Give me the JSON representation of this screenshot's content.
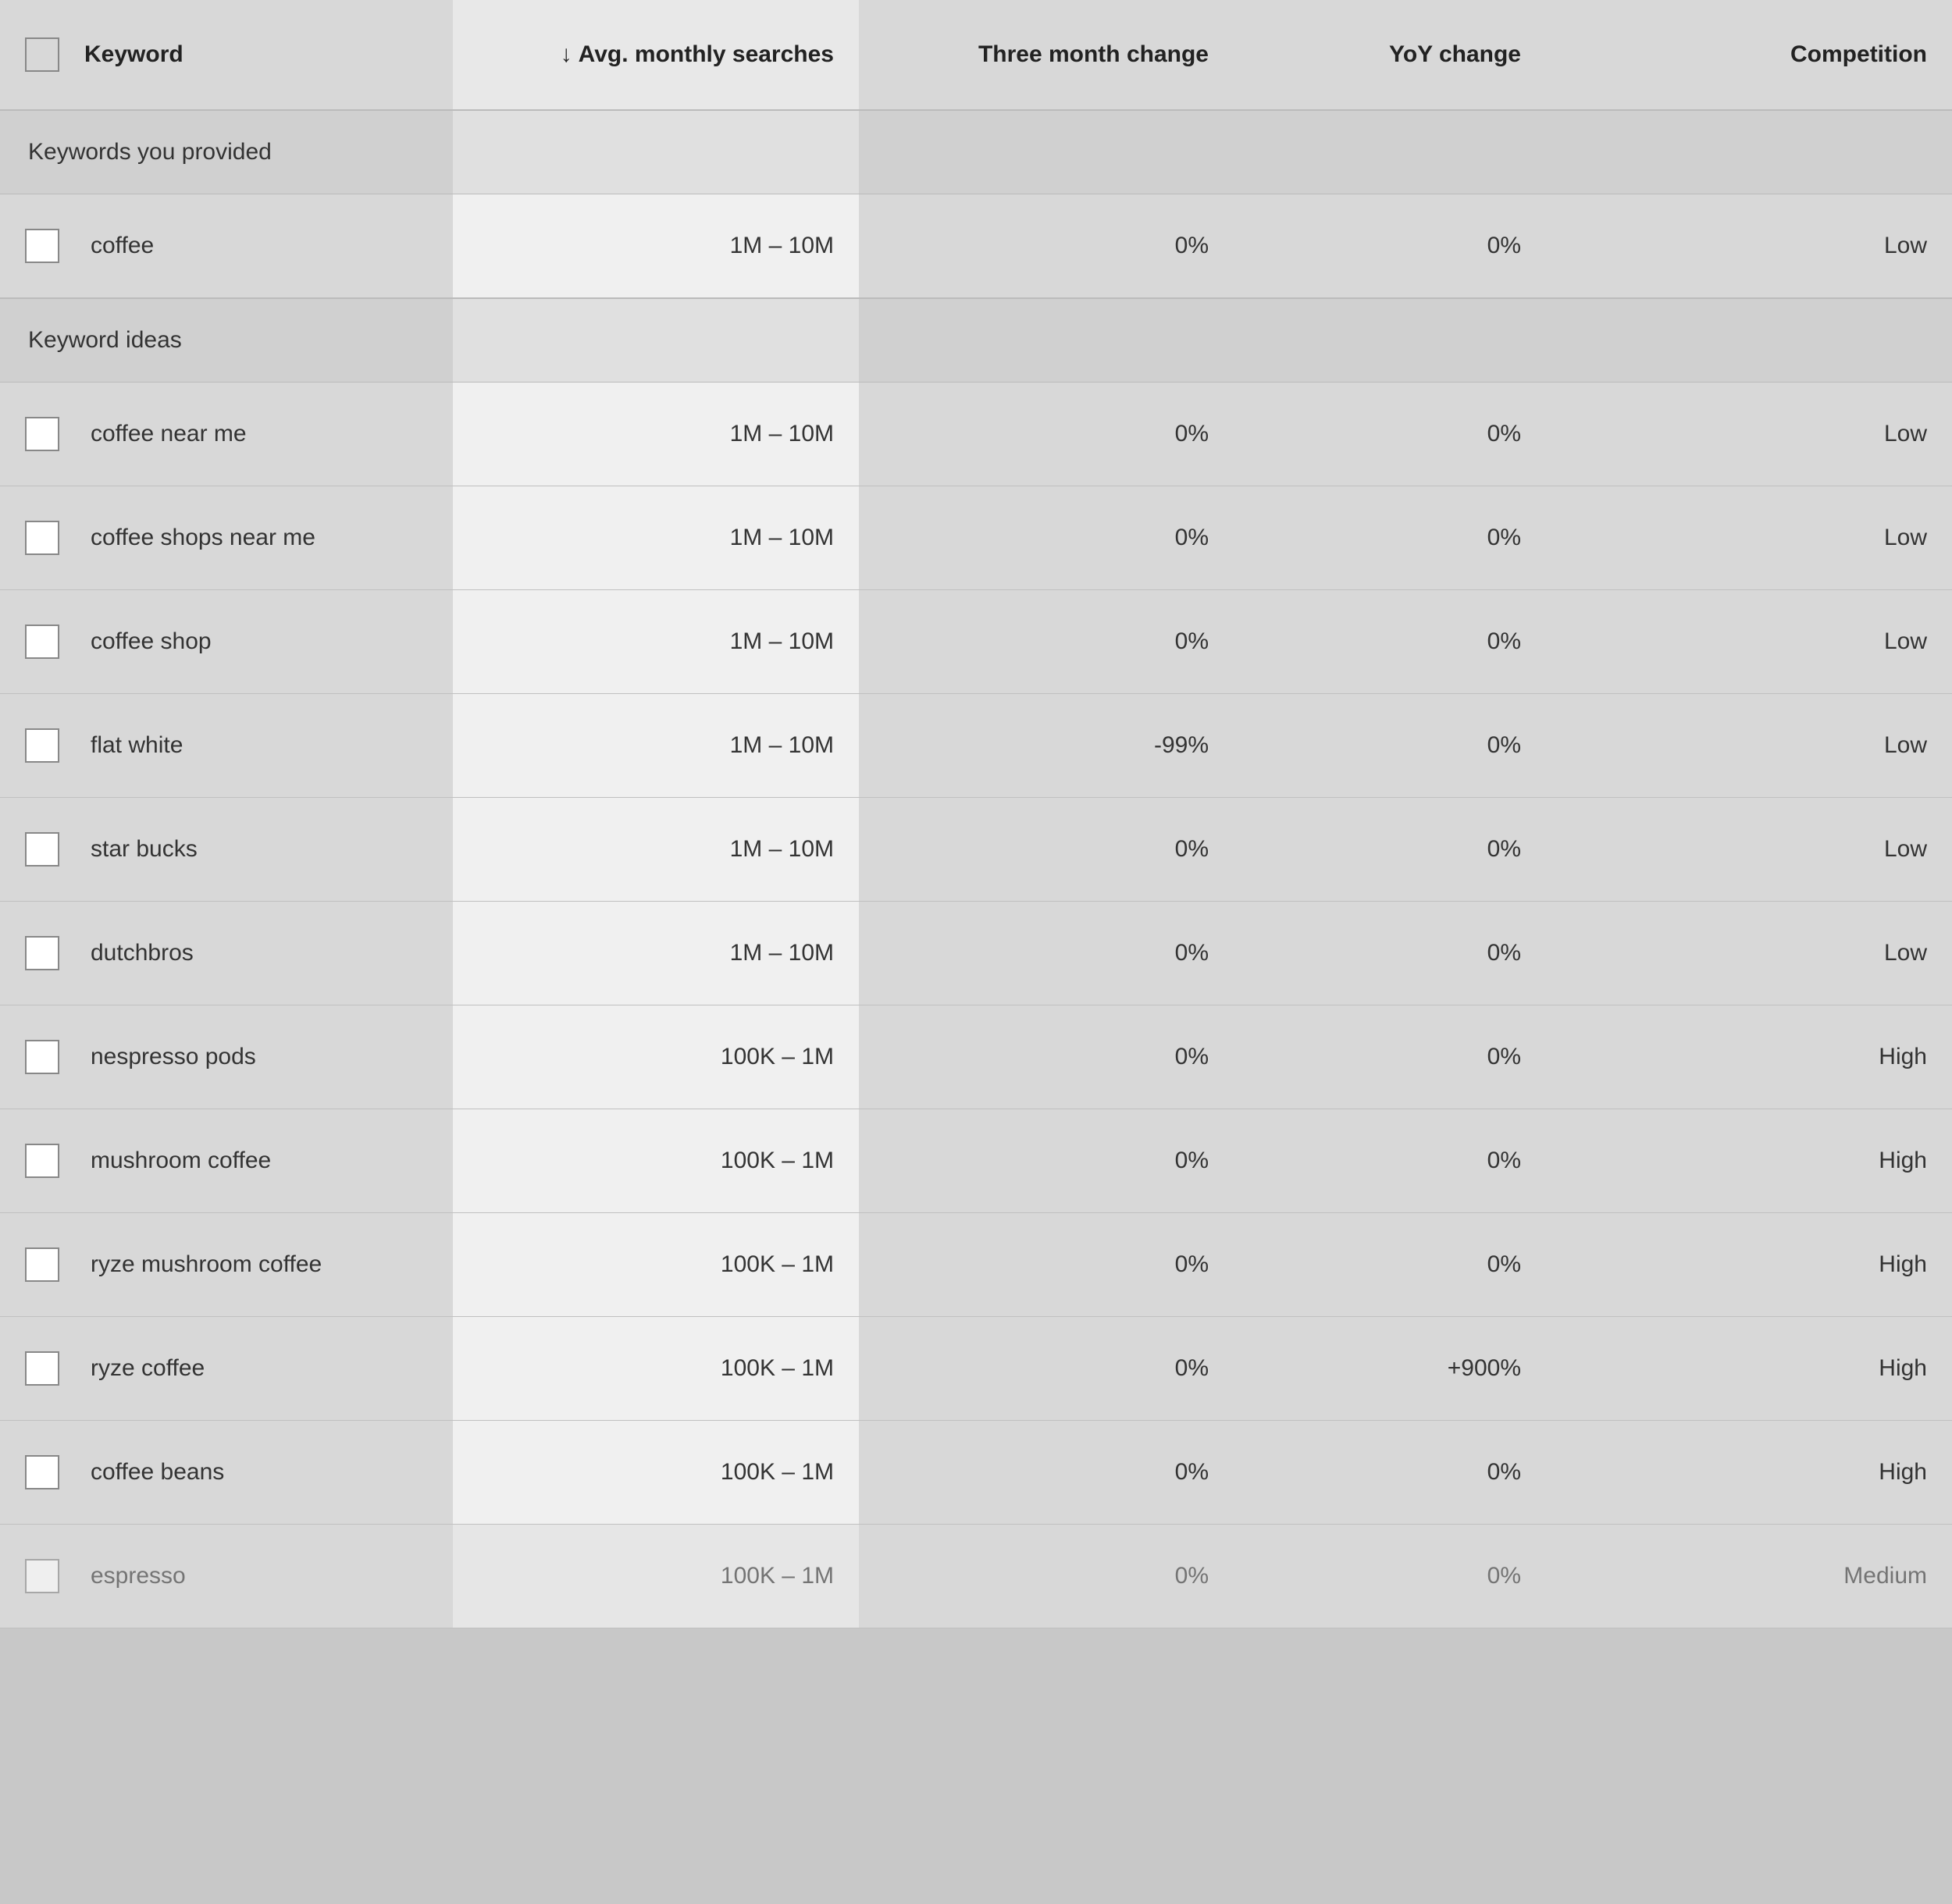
{
  "header": {
    "checkbox_label": "",
    "keyword_label": "Keyword",
    "avg_searches_label": "Avg. monthly searches",
    "three_month_label": "Three month change",
    "yoy_label": "YoY change",
    "competition_label": "Competition",
    "sort_icon": "↓"
  },
  "sections": [
    {
      "id": "provided",
      "label": "Keywords you provided",
      "rows": [
        {
          "keyword": "coffee",
          "avg_searches": "1M – 10M",
          "three_month": "0%",
          "yoy": "0%",
          "competition": "Low"
        }
      ]
    },
    {
      "id": "ideas",
      "label": "Keyword ideas",
      "rows": [
        {
          "keyword": "coffee near me",
          "avg_searches": "1M – 10M",
          "three_month": "0%",
          "yoy": "0%",
          "competition": "Low"
        },
        {
          "keyword": "coffee shops near me",
          "avg_searches": "1M – 10M",
          "three_month": "0%",
          "yoy": "0%",
          "competition": "Low"
        },
        {
          "keyword": "coffee shop",
          "avg_searches": "1M – 10M",
          "three_month": "0%",
          "yoy": "0%",
          "competition": "Low"
        },
        {
          "keyword": "flat white",
          "avg_searches": "1M – 10M",
          "three_month": "-99%",
          "yoy": "0%",
          "competition": "Low"
        },
        {
          "keyword": "star bucks",
          "avg_searches": "1M – 10M",
          "three_month": "0%",
          "yoy": "0%",
          "competition": "Low"
        },
        {
          "keyword": "dutchbros",
          "avg_searches": "1M – 10M",
          "three_month": "0%",
          "yoy": "0%",
          "competition": "Low"
        },
        {
          "keyword": "nespresso pods",
          "avg_searches": "100K – 1M",
          "three_month": "0%",
          "yoy": "0%",
          "competition": "High"
        },
        {
          "keyword": "mushroom coffee",
          "avg_searches": "100K – 1M",
          "three_month": "0%",
          "yoy": "0%",
          "competition": "High"
        },
        {
          "keyword": "ryze mushroom coffee",
          "avg_searches": "100K – 1M",
          "three_month": "0%",
          "yoy": "0%",
          "competition": "High"
        },
        {
          "keyword": "ryze coffee",
          "avg_searches": "100K – 1M",
          "three_month": "0%",
          "yoy": "+900%",
          "competition": "High"
        },
        {
          "keyword": "coffee beans",
          "avg_searches": "100K – 1M",
          "three_month": "0%",
          "yoy": "0%",
          "competition": "High"
        },
        {
          "keyword": "espresso",
          "avg_searches": "100K – 1M",
          "three_month": "0%",
          "yoy": "0%",
          "competition": "Medium",
          "partial": true
        }
      ]
    }
  ]
}
